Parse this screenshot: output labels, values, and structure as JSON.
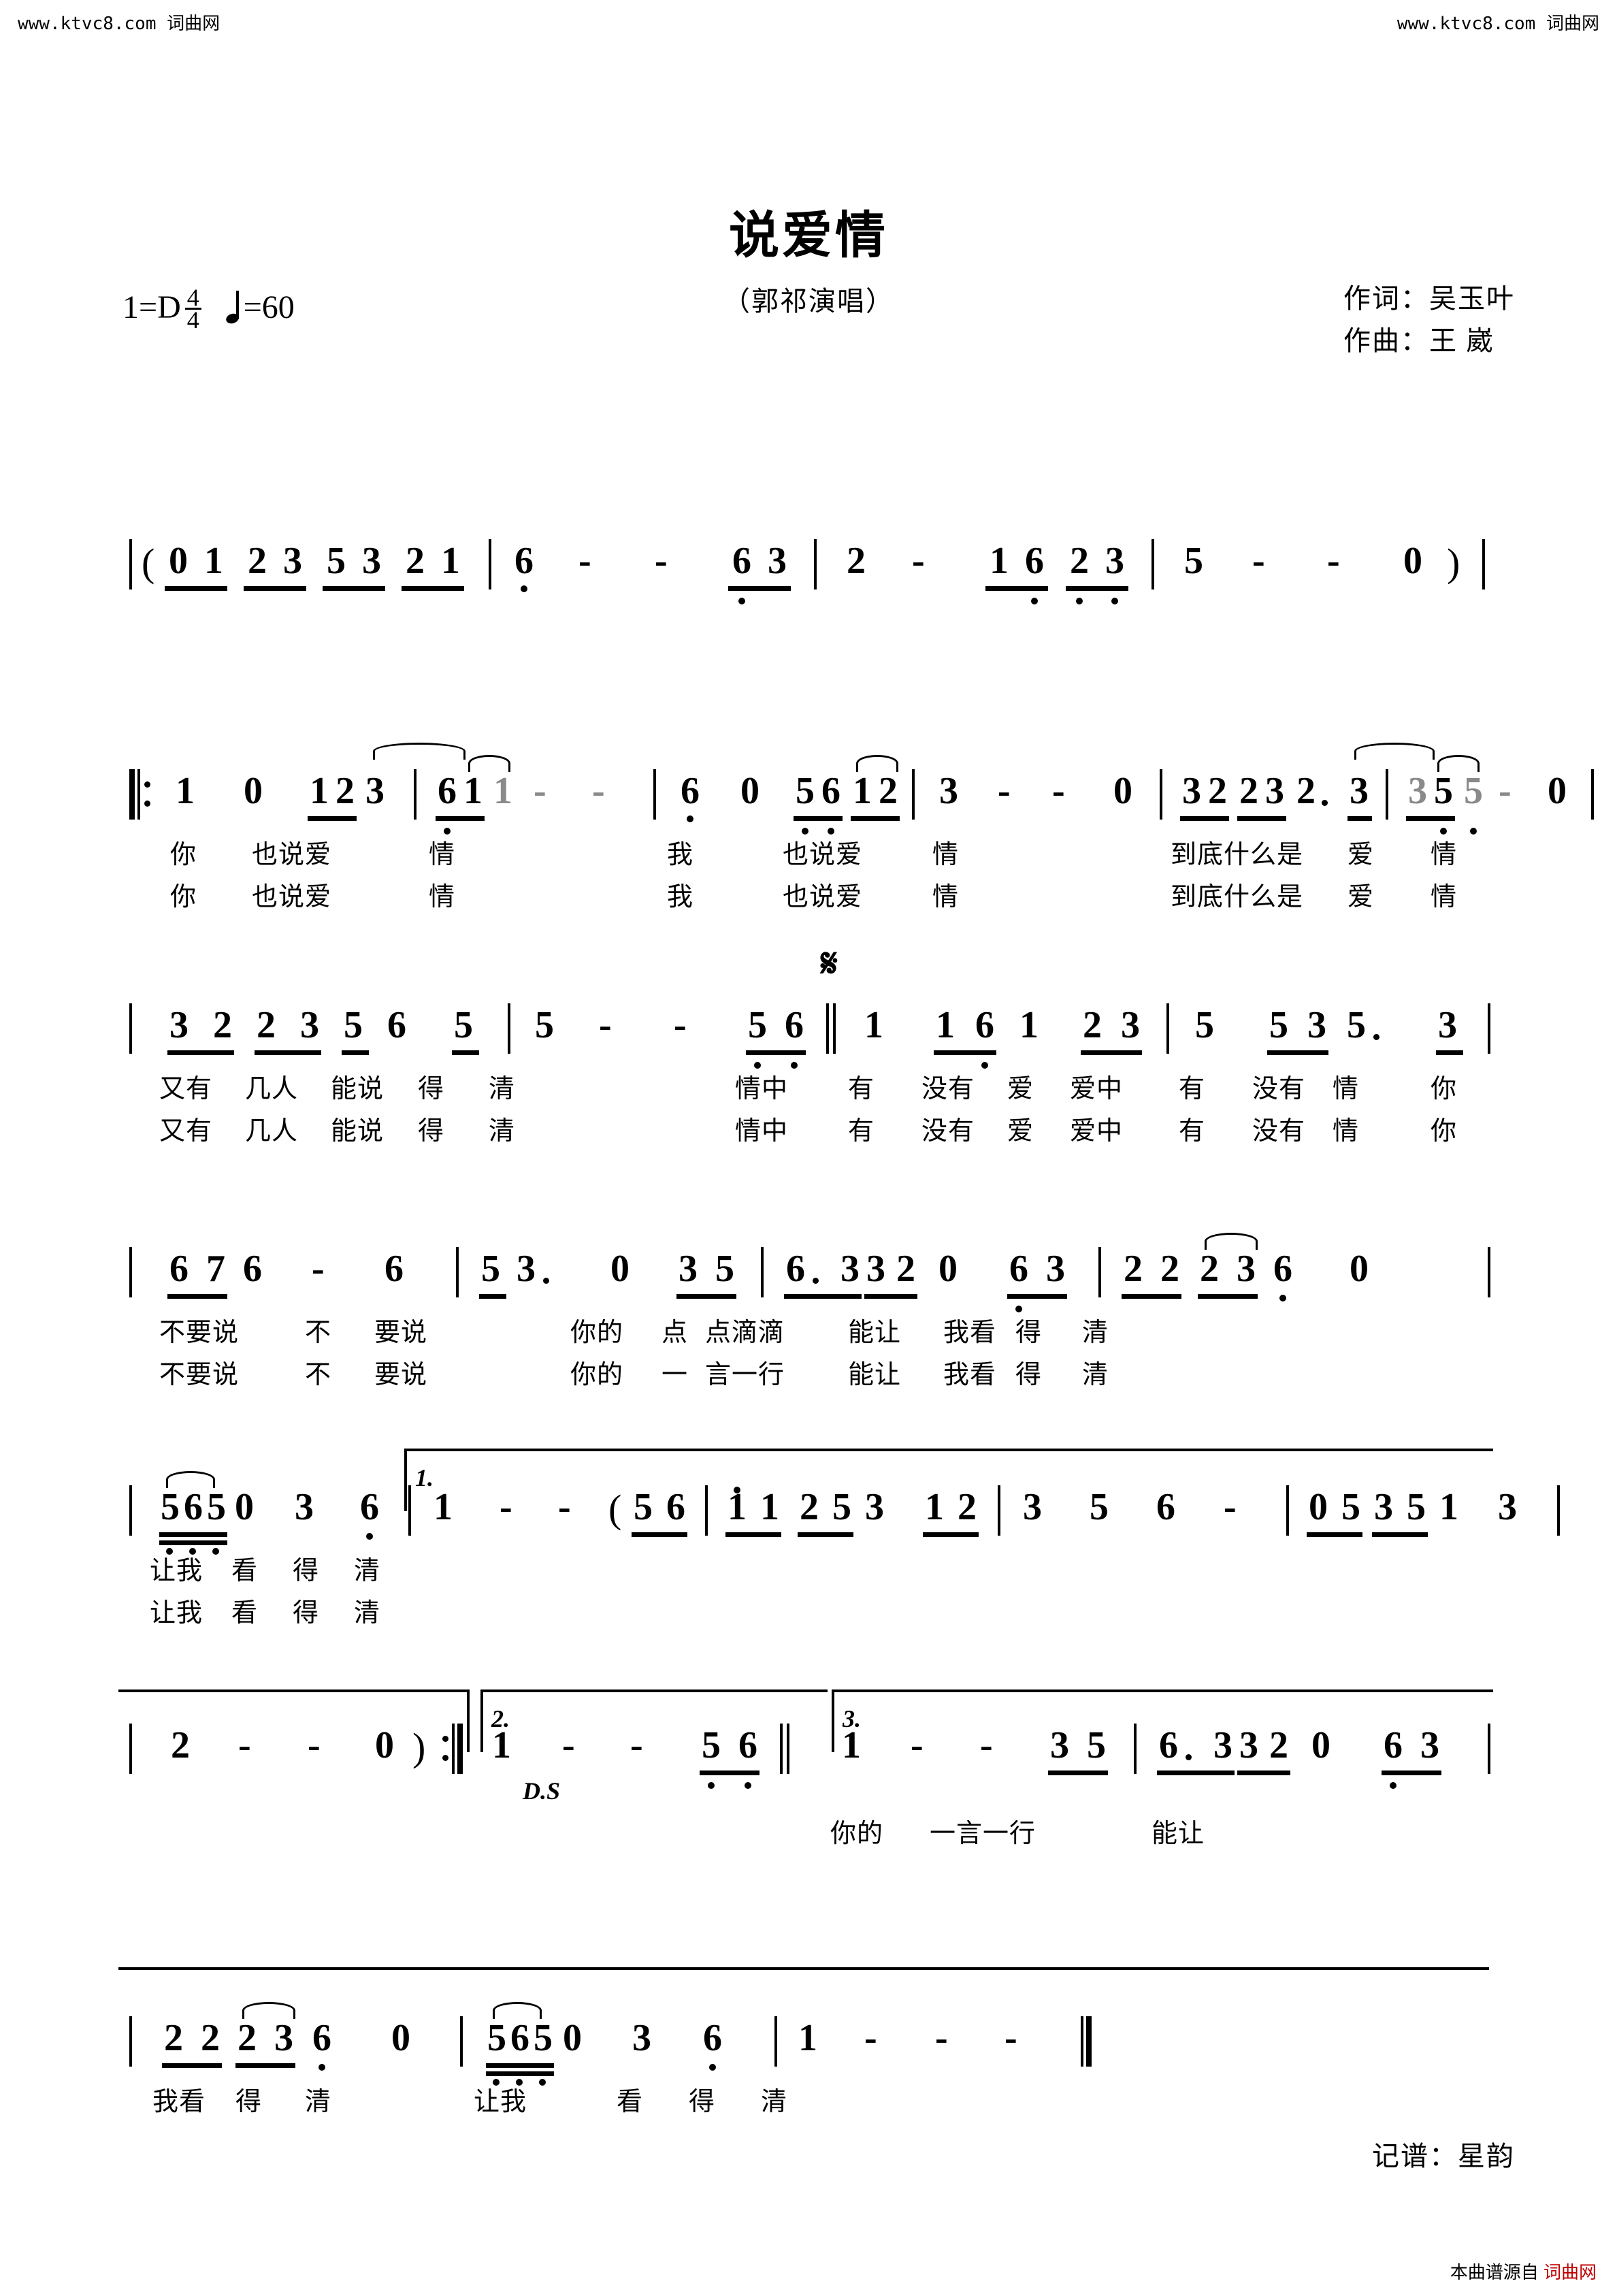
{
  "watermarks": {
    "top_left": "www.ktvc8.com 词曲网",
    "top_right": "www.ktvc8.com 词曲网",
    "bottom_prefix": "本曲谱源自 ",
    "bottom_site": "词曲网"
  },
  "header": {
    "title": "说爱情",
    "subtitle": "（郭祁演唱）",
    "key": "1=D",
    "meter_num": "4",
    "meter_den": "4",
    "tempo": "=60",
    "lyricist": "作词：吴玉叶",
    "composer": "作曲：王  崴",
    "transcriber": "记谱：星韵"
  },
  "marks": {
    "segno": "𝄋",
    "ds": "D.S",
    "volta1": "1.",
    "volta2": "2.",
    "volta3": "3."
  },
  "systems": [
    {
      "id": "system-1",
      "notes": [
        "(",
        "0",
        "1",
        "2",
        "3",
        "5",
        "3",
        "2",
        "1",
        "6",
        "-",
        "-",
        "6",
        "3",
        "2",
        "-",
        "1",
        "6",
        "2",
        "3",
        "5",
        "-",
        "-",
        "0",
        ")"
      ],
      "lyrics_row1": [],
      "lyrics_row2": []
    },
    {
      "id": "system-2",
      "notes": [
        "1",
        "0",
        "1",
        "2",
        "3",
        "6",
        "1",
        "1",
        "-",
        "-",
        "6",
        "0",
        "5",
        "6",
        "1",
        "2",
        "3",
        "-",
        "-",
        "0",
        "3",
        "2",
        "2",
        "3",
        "2",
        "3",
        "3",
        "5",
        "5",
        "-",
        "0"
      ],
      "lyrics_row1": [
        "你",
        "也说爱",
        "情",
        "我",
        "也说爱",
        "情",
        "到底什么是",
        "爱",
        "情"
      ],
      "lyrics_row2": [
        "你",
        "也说爱",
        "情",
        "我",
        "也说爱",
        "情",
        "到底什么是",
        "爱",
        "情"
      ]
    },
    {
      "id": "system-3",
      "notes": [
        "3",
        "2",
        "2",
        "3",
        "5",
        "6",
        "5",
        "5",
        "-",
        "-",
        "5",
        "6",
        "1",
        "1",
        "6",
        "1",
        "2",
        "3",
        "5",
        "5",
        "3",
        "5",
        "3"
      ],
      "lyrics_row1": [
        "又有",
        "几人",
        "能说",
        "得",
        "清",
        "情中",
        "有",
        "没有",
        "爱",
        "爱中",
        "有",
        "没有",
        "情",
        "你"
      ],
      "lyrics_row2": [
        "又有",
        "几人",
        "能说",
        "得",
        "清",
        "情中",
        "有",
        "没有",
        "爱",
        "爱中",
        "有",
        "没有",
        "情",
        "你"
      ]
    },
    {
      "id": "system-4",
      "notes": [
        "6",
        "7",
        "6",
        "-",
        "6",
        "5",
        "3",
        "0",
        "3",
        "5",
        "6",
        "3",
        "3",
        "2",
        "0",
        "6",
        "3",
        "2",
        "2",
        "2",
        "3",
        "6",
        "0"
      ],
      "lyrics_row1": [
        "不要说",
        "不",
        "要说",
        "你的",
        "点",
        "点滴滴",
        "能让",
        "我看",
        "得",
        "清"
      ],
      "lyrics_row2": [
        "不要说",
        "不",
        "要说",
        "你的",
        "一",
        "言一行",
        "能让",
        "我看",
        "得",
        "清"
      ]
    },
    {
      "id": "system-5",
      "notes": [
        "5",
        "6",
        "5",
        "0",
        "3",
        "6",
        "1",
        "-",
        "-",
        "(",
        "5",
        "6",
        "1",
        "1",
        "2",
        "5",
        "3",
        "1",
        "2",
        "3",
        "5",
        "6",
        "-",
        "0",
        "5",
        "3",
        "5",
        "1",
        "3"
      ],
      "lyrics_row1": [
        "让我",
        "看",
        "得",
        "清"
      ],
      "lyrics_row2": [
        "让我",
        "看",
        "得",
        "清"
      ]
    },
    {
      "id": "system-6",
      "notes": [
        "2",
        "-",
        "-",
        "0",
        ")",
        "1",
        "-",
        "-",
        "5",
        "6",
        "1",
        "-",
        "-",
        "3",
        "5",
        "6",
        "3",
        "3",
        "2",
        "0",
        "6",
        "3"
      ],
      "lyrics_row1": [
        "你的",
        "一言一行",
        "能让"
      ],
      "lyrics_row2": []
    },
    {
      "id": "system-7",
      "notes": [
        "2",
        "2",
        "2",
        "3",
        "6",
        "0",
        "5",
        "6",
        "5",
        "0",
        "3",
        "6",
        "1",
        "-",
        "-",
        "-"
      ],
      "lyrics_row1": [
        "我看",
        "得",
        "清",
        "让我",
        "看",
        "得",
        "清"
      ],
      "lyrics_row2": []
    }
  ]
}
